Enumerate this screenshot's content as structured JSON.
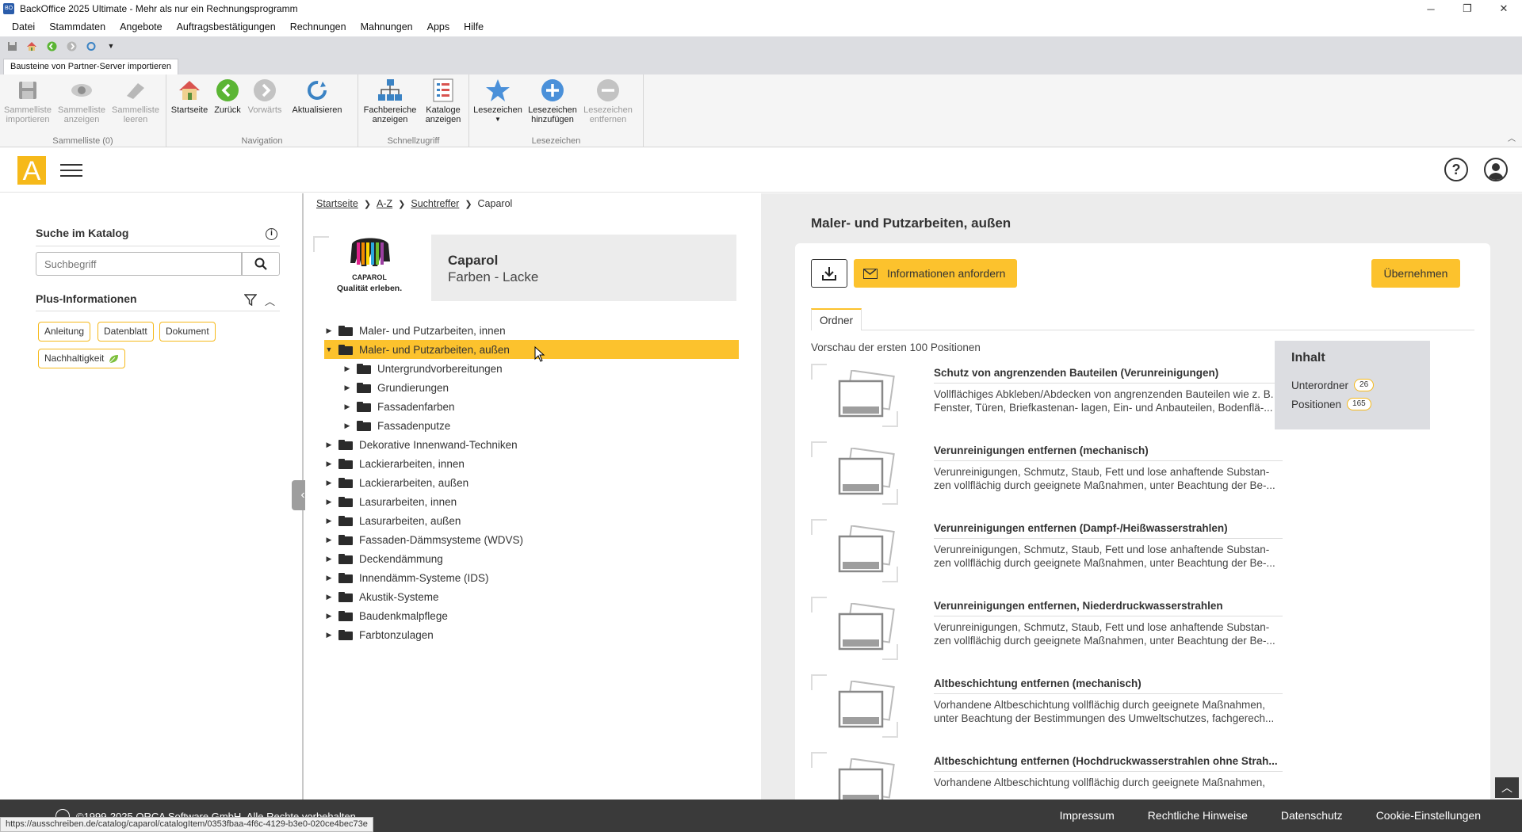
{
  "window": {
    "title": "BackOffice 2025 Ultimate - Mehr als nur ein Rechnungsprogramm",
    "minimize": "─",
    "maximize": "❐",
    "close": "✕"
  },
  "menu": [
    "Datei",
    "Stammdaten",
    "Angebote",
    "Auftragsbestätigungen",
    "Rechnungen",
    "Mahnungen",
    "Apps",
    "Hilfe"
  ],
  "ribbon": {
    "tab": "Bausteine von Partner-Server importieren",
    "groups": {
      "sammelliste": "Sammelliste (0)",
      "navigation": "Navigation",
      "schnellzugriff": "Schnellzugriff",
      "lesezeichen": "Lesezeichen"
    },
    "buttons": {
      "import_l1": "Sammelliste",
      "import_l2": "importieren",
      "show_l1": "Sammelliste",
      "show_l2": "anzeigen",
      "clear_l1": "Sammelliste",
      "clear_l2": "leeren",
      "home": "Startseite",
      "back": "Zurück",
      "forward": "Vorwärts",
      "refresh": "Aktualisieren",
      "fach_l1": "Fachbereiche",
      "fach_l2": "anzeigen",
      "kat_l1": "Kataloge",
      "kat_l2": "anzeigen",
      "bookmarks": "Lesezeichen",
      "addbm_l1": "Lesezeichen",
      "addbm_l2": "hinzufügen",
      "rmbm_l1": "Lesezeichen",
      "rmbm_l2": "entfernen"
    }
  },
  "header": {
    "logo_letter": "A",
    "help": "?"
  },
  "left": {
    "search_title": "Suche im Katalog",
    "search_placeholder": "Suchbegriff",
    "plus_title": "Plus-Informationen",
    "chips": [
      "Anleitung",
      "Datenblatt",
      "Dokument",
      "Nachhaltigkeit"
    ]
  },
  "breadcrumb": [
    "Startseite",
    "A-Z",
    "Suchtreffer",
    "Caparol"
  ],
  "manufacturer": {
    "name": "Caparol",
    "subtitle": "Farben - Lacke",
    "logo_text": "CAPAROL",
    "logo_tagline": "Qualität erleben."
  },
  "tree": [
    {
      "label": "Maler- und Putzarbeiten, innen",
      "level": 0,
      "expanded": false,
      "selected": false
    },
    {
      "label": "Maler- und Putzarbeiten, außen",
      "level": 0,
      "expanded": true,
      "selected": true
    },
    {
      "label": "Untergrundvorbereitungen",
      "level": 1,
      "expanded": false,
      "selected": false
    },
    {
      "label": "Grundierungen",
      "level": 1,
      "expanded": false,
      "selected": false
    },
    {
      "label": "Fassadenfarben",
      "level": 1,
      "expanded": false,
      "selected": false
    },
    {
      "label": "Fassadenputze",
      "level": 1,
      "expanded": false,
      "selected": false
    },
    {
      "label": "Dekorative Innenwand-Techniken",
      "level": 0,
      "expanded": false,
      "selected": false
    },
    {
      "label": "Lackierarbeiten, innen",
      "level": 0,
      "expanded": false,
      "selected": false
    },
    {
      "label": "Lackierarbeiten, außen",
      "level": 0,
      "expanded": false,
      "selected": false
    },
    {
      "label": "Lasurarbeiten, innen",
      "level": 0,
      "expanded": false,
      "selected": false
    },
    {
      "label": "Lasurarbeiten, außen",
      "level": 0,
      "expanded": false,
      "selected": false
    },
    {
      "label": "Fassaden-Dämmsysteme (WDVS)",
      "level": 0,
      "expanded": false,
      "selected": false
    },
    {
      "label": "Deckendämmung",
      "level": 0,
      "expanded": false,
      "selected": false
    },
    {
      "label": "Innendämm-Systeme (IDS)",
      "level": 0,
      "expanded": false,
      "selected": false
    },
    {
      "label": "Akustik-Systeme",
      "level": 0,
      "expanded": false,
      "selected": false
    },
    {
      "label": "Baudenkmalpflege",
      "level": 0,
      "expanded": false,
      "selected": false
    },
    {
      "label": "Farbtonzulagen",
      "level": 0,
      "expanded": false,
      "selected": false
    }
  ],
  "right": {
    "title": "Maler- und Putzarbeiten, außen",
    "info_button": "Informationen anfordern",
    "take_button": "Übernehmen",
    "tab": "Ordner",
    "preview_text": "Vorschau der ersten 100 Positionen",
    "items": [
      {
        "title": "Schutz von angrenzenden Bauteilen (Verunreinigungen)",
        "desc1": "Vollflächiges Abkleben/Abdecken von angrenzenden Bauteilen wie z. B.",
        "desc2": "Fenster, Türen, Briefkastenan- lagen, Ein- und Anbauteilen, Bodenflä-..."
      },
      {
        "title": "Verunreinigungen entfernen (mechanisch)",
        "desc1": "Verunreinigungen, Schmutz, Staub, Fett und lose anhaftende Substan-",
        "desc2": "zen vollflächig durch geeignete Maßnahmen, unter Beachtung der Be-..."
      },
      {
        "title": "Verunreinigungen entfernen (Dampf-/Heißwasserstrahlen)",
        "desc1": "Verunreinigungen, Schmutz, Staub, Fett und lose anhaftende Substan-",
        "desc2": "zen vollflächig durch geeignete Maßnahmen, unter Beachtung der Be-..."
      },
      {
        "title": "Verunreinigungen entfernen, Niederdruckwasserstrahlen",
        "desc1": "Verunreinigungen, Schmutz, Staub, Fett und lose anhaftende Substan-",
        "desc2": "zen vollflächig durch geeignete Maßnahmen, unter Beachtung der Be-..."
      },
      {
        "title": "Altbeschichtung entfernen (mechanisch)",
        "desc1": "Vorhandene Altbeschichtung vollflächig durch geeignete Maßnahmen,",
        "desc2": "unter Beachtung der Bestimmungen des Umweltschutzes, fachgerech..."
      },
      {
        "title": "Altbeschichtung entfernen (Hochdruckwasserstrahlen ohne Strah...",
        "desc1": "Vorhandene Altbeschichtung vollflächig durch geeignete Maßnahmen,",
        "desc2": ""
      }
    ],
    "inhalt": {
      "title": "Inhalt",
      "unterordner_label": "Unterordner",
      "unterordner_count": "26",
      "positionen_label": "Positionen",
      "positionen_count": "165"
    }
  },
  "footer": {
    "copyright": "©1999-2025 ORCA Software GmbH. Alle Rechte vorbehalten.",
    "links": [
      "Impressum",
      "Rechtliche Hinweise",
      "Datenschutz",
      "Cookie-Einstellungen"
    ]
  },
  "status_url": "https://ausschreiben.de/catalog/caparol/catalogItem/0353fbaa-4f6c-4129-b3e0-020ce4bec73e"
}
